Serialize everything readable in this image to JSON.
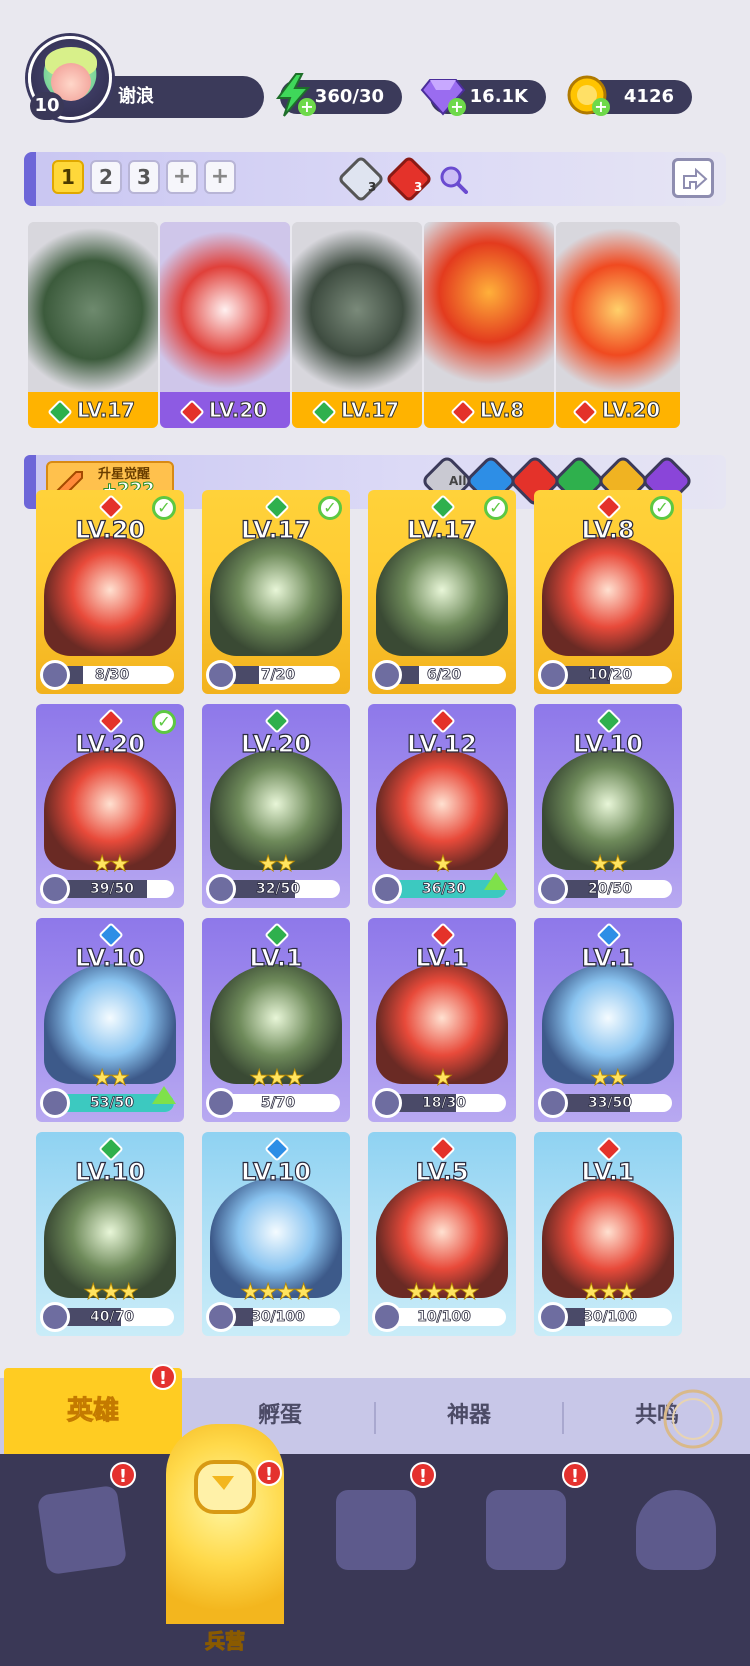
{
  "player": {
    "level": "10",
    "name": "谢浪"
  },
  "resources": {
    "energy": "360/30",
    "gems": "16.1K",
    "gold": "4126"
  },
  "team_bar": {
    "slots": [
      "1",
      "2",
      "3",
      "+",
      "+"
    ],
    "badge_water": "3",
    "badge_fire": "3"
  },
  "team": [
    {
      "level": "LV.17",
      "element": "wind"
    },
    {
      "level": "LV.20",
      "element": "fire"
    },
    {
      "level": "LV.17",
      "element": "wind"
    },
    {
      "level": "LV.8",
      "element": "fire"
    },
    {
      "level": "LV.20",
      "element": "fire"
    }
  ],
  "awaken": {
    "label": "升星觉醒",
    "value": "+222"
  },
  "filters": [
    "All",
    "water",
    "fire",
    "wind",
    "light",
    "dark"
  ],
  "heroes": [
    {
      "level": "LV.20",
      "element": "fire",
      "shards": "8/30",
      "shard_fraction": 0.27,
      "stars": "",
      "theme": "gold",
      "checked": true,
      "upgrade": false
    },
    {
      "level": "LV.17",
      "element": "wind",
      "shards": "7/20",
      "shard_fraction": 0.35,
      "stars": "",
      "theme": "gold",
      "checked": true,
      "upgrade": false
    },
    {
      "level": "LV.17",
      "element": "wind",
      "shards": "6/20",
      "shard_fraction": 0.3,
      "stars": "",
      "theme": "gold",
      "checked": true,
      "upgrade": false
    },
    {
      "level": "LV.8",
      "element": "fire",
      "shards": "10/20",
      "shard_fraction": 0.5,
      "stars": "",
      "theme": "gold",
      "checked": true,
      "upgrade": false
    },
    {
      "level": "LV.20",
      "element": "fire",
      "shards": "39/50",
      "shard_fraction": 0.78,
      "stars": "★★",
      "theme": "purple",
      "checked": true,
      "upgrade": false
    },
    {
      "level": "LV.20",
      "element": "wind",
      "shards": "32/50",
      "shard_fraction": 0.64,
      "stars": "★★",
      "theme": "purple",
      "checked": false,
      "upgrade": false
    },
    {
      "level": "LV.12",
      "element": "fire",
      "shards": "36/30",
      "shard_fraction": 1.0,
      "stars": "★",
      "theme": "purple",
      "checked": false,
      "upgrade": true
    },
    {
      "level": "LV.10",
      "element": "wind",
      "shards": "20/50",
      "shard_fraction": 0.4,
      "stars": "★★",
      "theme": "purple",
      "checked": false,
      "upgrade": false
    },
    {
      "level": "LV.10",
      "element": "water",
      "shards": "53/50",
      "shard_fraction": 1.0,
      "stars": "★★",
      "theme": "purple",
      "checked": false,
      "upgrade": true
    },
    {
      "level": "LV.1",
      "element": "wind",
      "shards": "5/70",
      "shard_fraction": 0.07,
      "stars": "★★★",
      "theme": "purple",
      "checked": false,
      "upgrade": false
    },
    {
      "level": "LV.1",
      "element": "fire",
      "shards": "18/30",
      "shard_fraction": 0.6,
      "stars": "★",
      "theme": "purple",
      "checked": false,
      "upgrade": false
    },
    {
      "level": "LV.1",
      "element": "water",
      "shards": "33/50",
      "shard_fraction": 0.66,
      "stars": "★★",
      "theme": "purple",
      "checked": false,
      "upgrade": false
    },
    {
      "level": "LV.10",
      "element": "wind",
      "shards": "40/70",
      "shard_fraction": 0.57,
      "stars": "★★★",
      "theme": "blue",
      "checked": false,
      "upgrade": false
    },
    {
      "level": "LV.10",
      "element": "water",
      "shards": "30/100",
      "shard_fraction": 0.3,
      "stars": "★★★★",
      "theme": "blue",
      "checked": false,
      "upgrade": false
    },
    {
      "level": "LV.5",
      "element": "fire",
      "shards": "10/100",
      "shard_fraction": 0.1,
      "stars": "★★★★",
      "theme": "blue",
      "checked": false,
      "upgrade": false
    },
    {
      "level": "LV.1",
      "element": "fire",
      "shards": "30/100",
      "shard_fraction": 0.3,
      "stars": "★★★",
      "theme": "blue",
      "checked": false,
      "upgrade": false
    }
  ],
  "sub_tabs": {
    "active": "英雄",
    "tab2": "孵蛋",
    "tab3": "神器",
    "tab4": "共鸣"
  },
  "alert_symbol": "!",
  "bottom_nav": {
    "active_label": "兵营"
  },
  "colors": {
    "accent": "#6d66d8",
    "gold": "#ffcc22",
    "nav_bg": "#3a3856",
    "alert": "#e4312e"
  }
}
